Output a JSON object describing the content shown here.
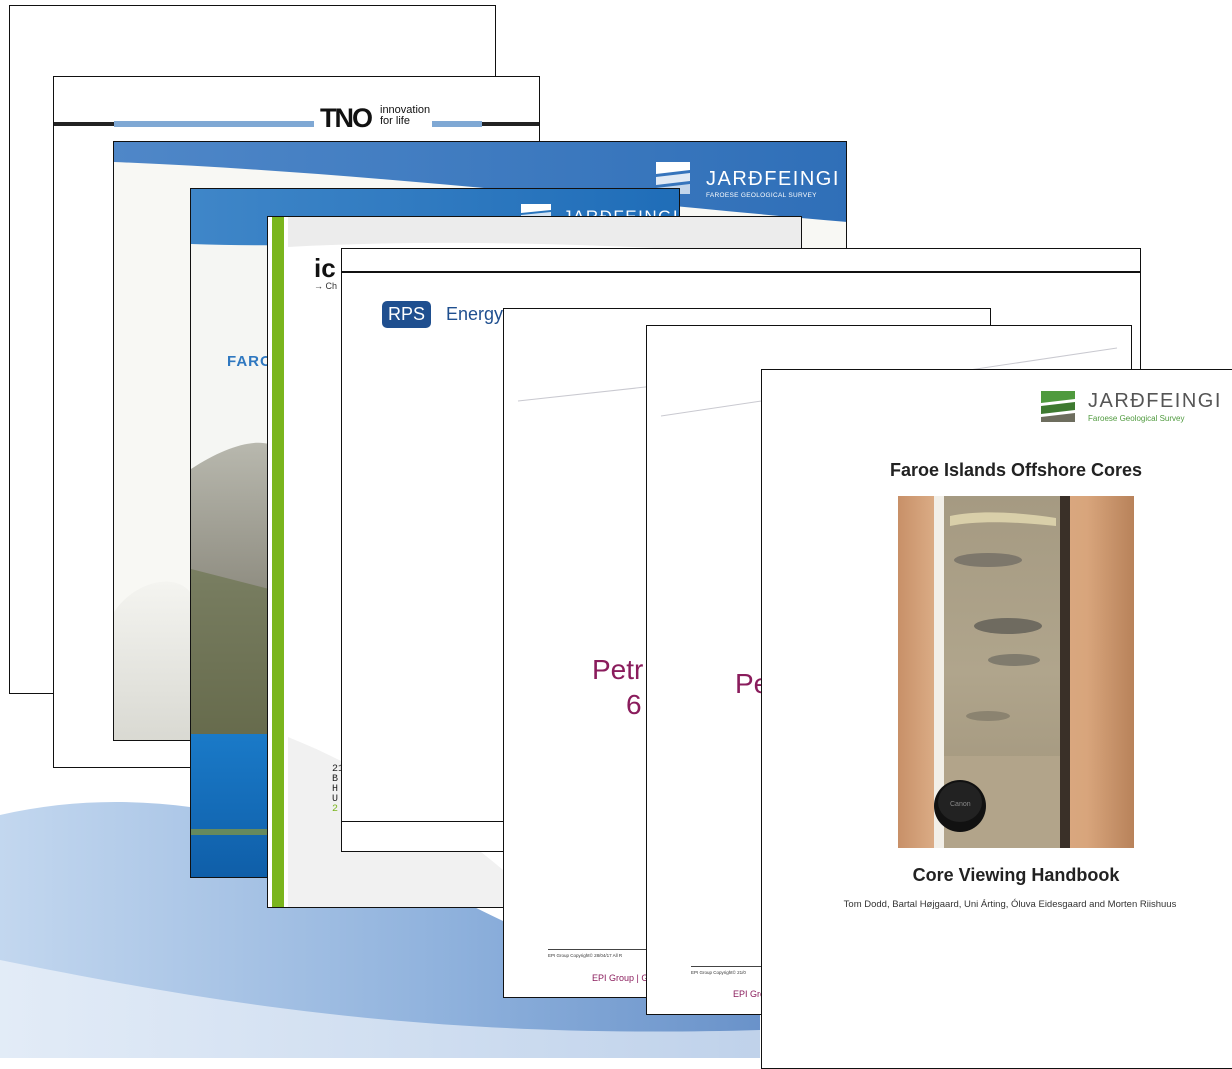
{
  "page_stack": {
    "tno_page": {
      "logo_text": "TNO",
      "tagline_line1": "innovation",
      "tagline_line2": "for life"
    },
    "jardfeingi_page": {
      "brand_name": "JARÐFEINGI",
      "brand_sub": "FAROESE GEOLOGICAL SURVEY",
      "partial_title": "FAROE"
    },
    "report_page_2": {
      "brand_partial": "JARÐFEINGI"
    },
    "chevron_page": {
      "logo_partial": "ic",
      "tagline_partial": "→ Ch",
      "address_lines": [
        "21",
        "B",
        "H",
        "U"
      ],
      "address_link": "2"
    },
    "rps_page": {
      "logo_box": "RPS",
      "logo_word": "Energy"
    },
    "epi_page_1": {
      "title_line1": "Petr",
      "title_line2": "6",
      "copyright": "EPI Group Copyright© 28/04/17 All R",
      "footer": "EPI Group | G"
    },
    "epi_page_2": {
      "title_line1": "Pe",
      "copyright": "EPI Group Copyright© 21/0",
      "footer": "EPI Gro"
    },
    "front_page": {
      "brand_name": "JARÐFEINGI",
      "brand_sub": "Faroese Geological Survey",
      "title": "Faroe Islands Offshore Cores",
      "lens_cap_text": "Canon",
      "subtitle": "Core Viewing Handbook",
      "authors": "Tom Dodd, Bartal Højgaard, Uni Árting, Óluva Eidesgaard and Morten Riishuus"
    }
  },
  "colors": {
    "jardfeingi_blue": "#2f6fb8",
    "jardfeingi_green": "#4f9a3e",
    "epi_purple": "#8a1c5c",
    "rps_blue": "#1f4f8f",
    "chevron_green": "#7ab51d",
    "tno_blue": "#7fa8d4"
  }
}
